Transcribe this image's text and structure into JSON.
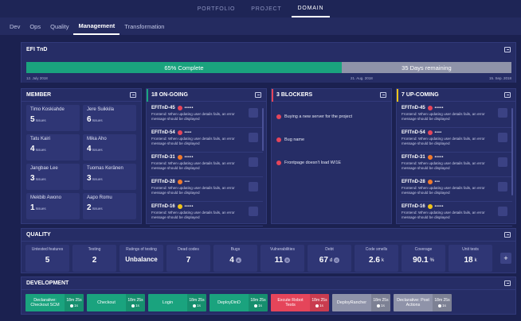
{
  "topnav": {
    "tabs": [
      "PORTFOLIO",
      "PROJECT",
      "DOMAIN"
    ],
    "active": "DOMAIN"
  },
  "subnav": {
    "tabs": [
      "Dev",
      "Ops",
      "Quality",
      "Management",
      "Transformation"
    ],
    "active": "Management"
  },
  "efi": {
    "title": "EFI TnD",
    "progress_fraction": 0.65,
    "complete_label": "65% Complete",
    "remaining_label": "35 Days remaining",
    "date_start": "12. July 2018",
    "date_mid": "21. Aug. 2018",
    "date_end": "15. Sep. 2018"
  },
  "member": {
    "title": "MEMBER",
    "issues_label": "Issues",
    "people": [
      {
        "name": "Timo Koskiahde",
        "issues": "5"
      },
      {
        "name": "Jere Suikkila",
        "issues": "6"
      },
      {
        "name": "Tatu Kairi",
        "issues": "4"
      },
      {
        "name": "Mika Aho",
        "issues": "4"
      },
      {
        "name": "Jangbae Lee",
        "issues": "3"
      },
      {
        "name": "Tuomas Keränen",
        "issues": "3"
      },
      {
        "name": "Mekbib Awono",
        "issues": "1"
      },
      {
        "name": "Aapo Romu",
        "issues": "2"
      }
    ]
  },
  "ongoing": {
    "title": "18 ON-GOING",
    "accent": "#1aa37e",
    "tickets": [
      {
        "id": "EFITnD-45",
        "dots": "•••••",
        "dot_color": "#e5455a",
        "desc": "Frontend: When updating user details fails, an error message should be displayed"
      },
      {
        "id": "EFITnD-54",
        "dots": "••••",
        "dot_color": "#e5455a",
        "desc": "Frontend: When updating user details fails, an error message should be displayed"
      },
      {
        "id": "EFITnD-31",
        "dots": "•••••",
        "dot_color": "#f07a2c",
        "desc": "Frontend: When updating user details fails, an error message should be displayed"
      },
      {
        "id": "EFITnD-28",
        "dots": "•••",
        "dot_color": "#f07a2c",
        "desc": "Frontend: When updating user details fails, an error message should be displayed"
      },
      {
        "id": "EFITnD-16",
        "dots": "•••••",
        "dot_color": "#f0c419",
        "desc": "Frontend: When updating user details fails, an error message should be displayed"
      }
    ]
  },
  "blockers": {
    "title": "3 BLOCKERS",
    "accent": "#e5455a",
    "items": [
      "Buying a new server for the project",
      "Bug name",
      "Frontpage doesn't load W/1E"
    ]
  },
  "upcoming": {
    "title": "7 UP-COMING",
    "accent": "#f0c419",
    "tickets": [
      {
        "id": "EFITnD-45",
        "dots": "•••••",
        "dot_color": "#e5455a",
        "desc": "Frontend: When updating user details fails, an error message should be displayed"
      },
      {
        "id": "EFITnD-54",
        "dots": "••••",
        "dot_color": "#e5455a",
        "desc": "Frontend: When updating user details fails, an error message should be displayed"
      },
      {
        "id": "EFITnD-31",
        "dots": "•••••",
        "dot_color": "#f07a2c",
        "desc": "Frontend: When updating user details fails, an error message should be displayed"
      },
      {
        "id": "EFITnD-28",
        "dots": "•••",
        "dot_color": "#f07a2c",
        "desc": "Frontend: When updating user details fails, an error message should be displayed"
      },
      {
        "id": "EFITnD-16",
        "dots": "•••••",
        "dot_color": "#f0c419",
        "desc": "Frontend: When updating user details fails, an error message should be displayed"
      }
    ]
  },
  "quality": {
    "title": "QUALITY",
    "metrics": [
      {
        "label": "Untested features",
        "value": "5"
      },
      {
        "label": "Testing",
        "value": "2"
      },
      {
        "label": "Ratings of testing",
        "value": "Unbalance"
      },
      {
        "label": "Dead codes",
        "value": "7"
      },
      {
        "label": "Bugs",
        "value": "4",
        "badge": "A"
      },
      {
        "label": "Vulnerabilities",
        "value": "11",
        "badge": "D"
      },
      {
        "label": "Debt",
        "value": "67",
        "unit": "d",
        "badge": "C"
      },
      {
        "label": "Code smells",
        "value": "2.6",
        "unit": "k"
      },
      {
        "label": "Coverage",
        "value": "90.1",
        "unit": "%"
      },
      {
        "label": "Unit tests",
        "value": "18",
        "unit": "k"
      }
    ],
    "add_label": "+"
  },
  "development": {
    "title": "DEVELOPMENT",
    "jobs": [
      {
        "name": "Declarative: Checkout SCM",
        "time": "18m 25s",
        "clock": "1s",
        "color": "#1aa37e"
      },
      {
        "name": "Checkout",
        "time": "18m 25s",
        "clock": "1s",
        "color": "#1aa37e"
      },
      {
        "name": "Login",
        "time": "18m 25s",
        "clock": "1s",
        "color": "#1aa37e"
      },
      {
        "name": "DeployDinD",
        "time": "18m 25s",
        "clock": "1s",
        "color": "#1aa37e"
      },
      {
        "name": "Excute Robot Tests",
        "time": "18m 25s",
        "clock": "1s",
        "color": "#e5455a"
      },
      {
        "name": "DeployRancher",
        "time": "18m 25s",
        "clock": "1s",
        "color": "#8f93a9"
      },
      {
        "name": "Declarative: Post Actions",
        "time": "18m 25s",
        "clock": "1s",
        "color": "#8f93a9"
      }
    ]
  }
}
